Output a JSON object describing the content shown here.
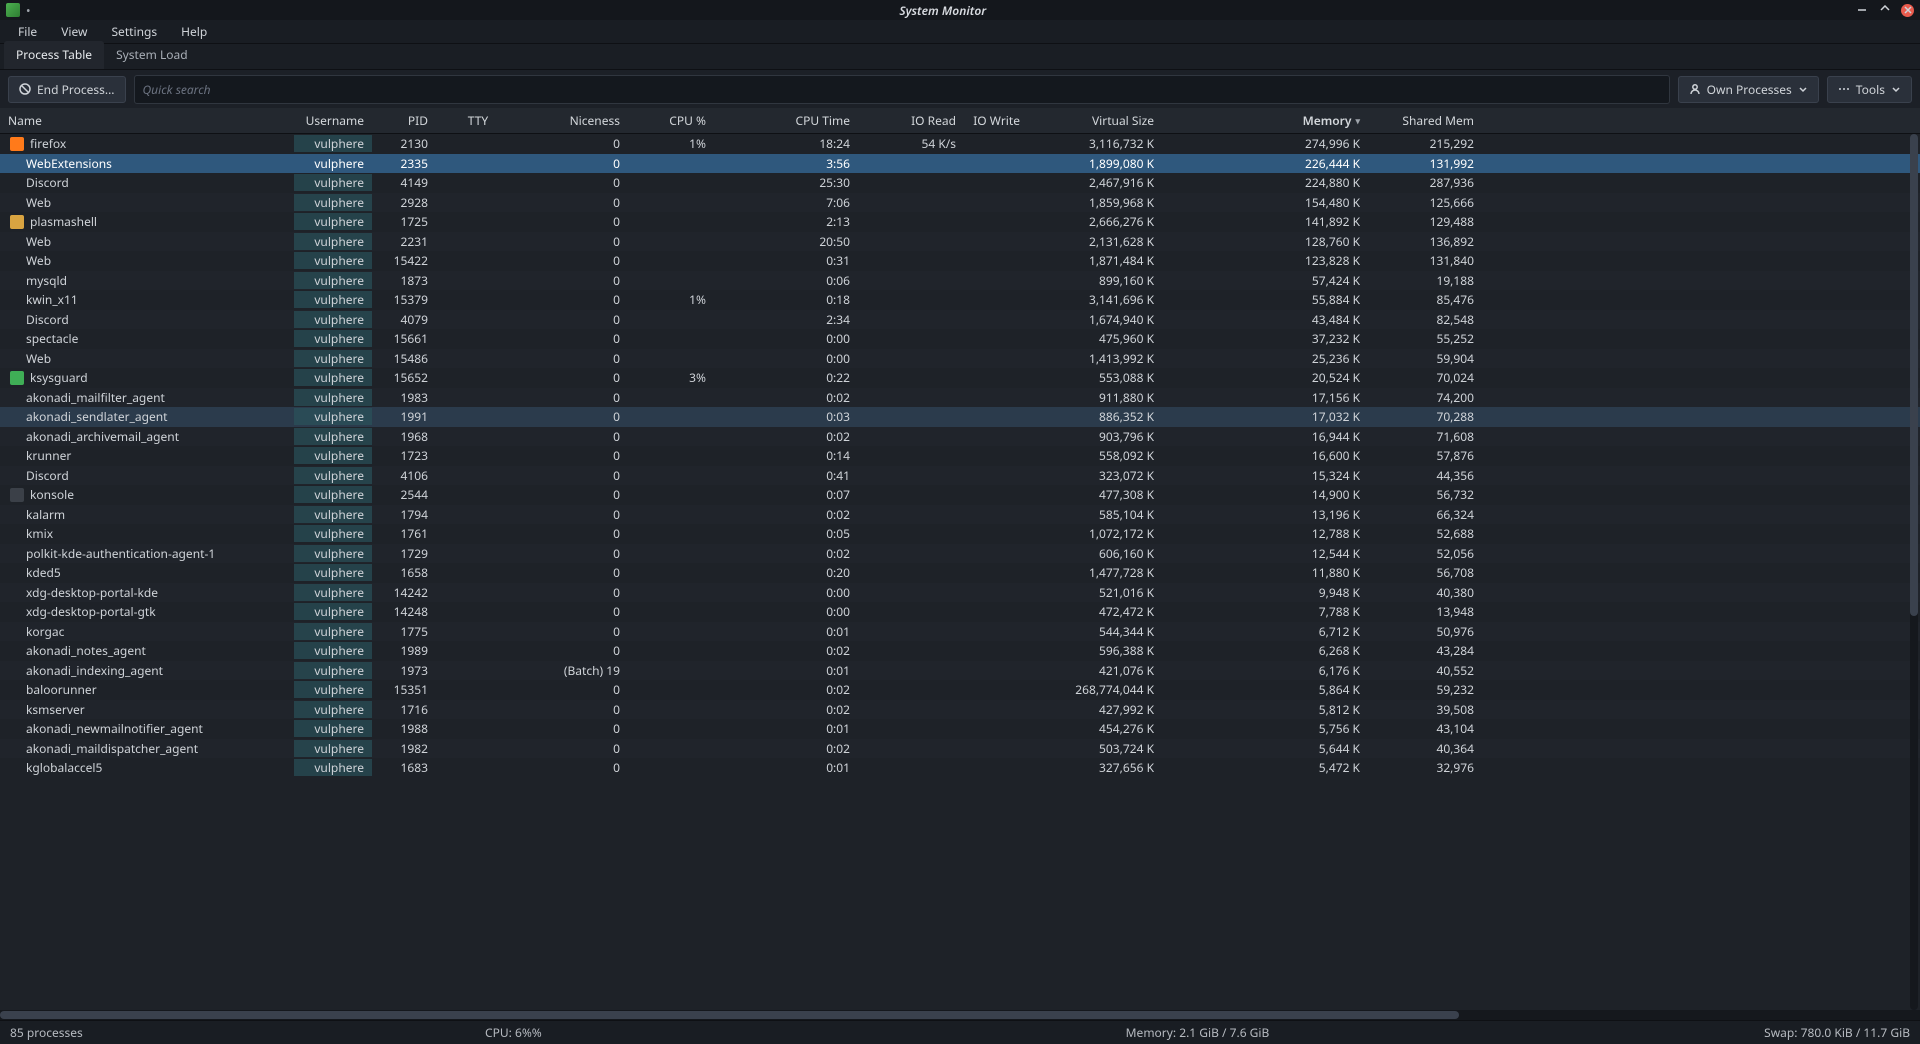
{
  "window": {
    "title": "System Monitor",
    "modified_mark": "•"
  },
  "menubar": [
    "File",
    "View",
    "Settings",
    "Help"
  ],
  "tabs": [
    {
      "label": "Process Table",
      "active": true
    },
    {
      "label": "System Load",
      "active": false
    }
  ],
  "toolbar": {
    "end_process_label": "End Process...",
    "search_placeholder": "Quick search",
    "filter_label": "Own Processes",
    "tools_label": "Tools"
  },
  "columns": [
    {
      "label": "Name",
      "align": "left"
    },
    {
      "label": "Username",
      "align": "right"
    },
    {
      "label": "PID",
      "align": "right"
    },
    {
      "label": "TTY",
      "align": "center"
    },
    {
      "label": "Niceness",
      "align": "right"
    },
    {
      "label": "CPU %",
      "align": "right"
    },
    {
      "label": "CPU Time",
      "align": "right"
    },
    {
      "label": "IO Read",
      "align": "right"
    },
    {
      "label": "IO Write",
      "align": "right"
    },
    {
      "label": "Virtual Size",
      "align": "right"
    },
    {
      "label": "Memory",
      "align": "right",
      "sorted": true
    },
    {
      "label": "Shared Mem",
      "align": "right"
    }
  ],
  "rows": [
    {
      "depth": 1,
      "icon": "firefox",
      "name": "firefox",
      "user": "vulphere",
      "pid": "2130",
      "tty": "",
      "nice": "0",
      "cpu": "1%",
      "cputime": "18:24",
      "ioread": "54 K/s",
      "iowrite": "",
      "vsize": "3,116,732 K",
      "mem": "274,996 K",
      "shmem": "215,292"
    },
    {
      "depth": 2,
      "name": "WebExtensions",
      "user": "vulphere",
      "pid": "2335",
      "tty": "",
      "nice": "0",
      "cpu": "",
      "cputime": "3:56",
      "ioread": "",
      "iowrite": "",
      "vsize": "1,899,080 K",
      "mem": "226,444 K",
      "shmem": "131,992",
      "selected": true
    },
    {
      "depth": 2,
      "name": "Discord",
      "user": "vulphere",
      "pid": "4149",
      "tty": "",
      "nice": "0",
      "cpu": "",
      "cputime": "25:30",
      "ioread": "",
      "iowrite": "",
      "vsize": "2,467,916 K",
      "mem": "224,880 K",
      "shmem": "287,936"
    },
    {
      "depth": 2,
      "name": "Web",
      "user": "vulphere",
      "pid": "2928",
      "tty": "",
      "nice": "0",
      "cpu": "",
      "cputime": "7:06",
      "ioread": "",
      "iowrite": "",
      "vsize": "1,859,968 K",
      "mem": "154,480 K",
      "shmem": "125,666"
    },
    {
      "depth": 1,
      "icon": "plasma",
      "name": "plasmashell",
      "user": "vulphere",
      "pid": "1725",
      "tty": "",
      "nice": "0",
      "cpu": "",
      "cputime": "2:13",
      "ioread": "",
      "iowrite": "",
      "vsize": "2,666,276 K",
      "mem": "141,892 K",
      "shmem": "129,488"
    },
    {
      "depth": 2,
      "name": "Web",
      "user": "vulphere",
      "pid": "2231",
      "tty": "",
      "nice": "0",
      "cpu": "",
      "cputime": "20:50",
      "ioread": "",
      "iowrite": "",
      "vsize": "2,131,628 K",
      "mem": "128,760 K",
      "shmem": "136,892"
    },
    {
      "depth": 2,
      "name": "Web",
      "user": "vulphere",
      "pid": "15422",
      "tty": "",
      "nice": "0",
      "cpu": "",
      "cputime": "0:31",
      "ioread": "",
      "iowrite": "",
      "vsize": "1,871,484 K",
      "mem": "123,828 K",
      "shmem": "131,840"
    },
    {
      "depth": 2,
      "name": "mysqld",
      "user": "vulphere",
      "pid": "1873",
      "tty": "",
      "nice": "0",
      "cpu": "",
      "cputime": "0:06",
      "ioread": "",
      "iowrite": "",
      "vsize": "899,160 K",
      "mem": "57,424 K",
      "shmem": "19,188"
    },
    {
      "depth": 2,
      "name": "kwin_x11",
      "user": "vulphere",
      "pid": "15379",
      "tty": "",
      "nice": "0",
      "cpu": "1%",
      "cputime": "0:18",
      "ioread": "",
      "iowrite": "",
      "vsize": "3,141,696 K",
      "mem": "55,884 K",
      "shmem": "85,476"
    },
    {
      "depth": 2,
      "name": "Discord",
      "user": "vulphere",
      "pid": "4079",
      "tty": "",
      "nice": "0",
      "cpu": "",
      "cputime": "2:34",
      "ioread": "",
      "iowrite": "",
      "vsize": "1,674,940 K",
      "mem": "43,484 K",
      "shmem": "82,548"
    },
    {
      "depth": 2,
      "name": "spectacle",
      "user": "vulphere",
      "pid": "15661",
      "tty": "",
      "nice": "0",
      "cpu": "",
      "cputime": "0:00",
      "ioread": "",
      "iowrite": "",
      "vsize": "475,960 K",
      "mem": "37,232 K",
      "shmem": "55,252"
    },
    {
      "depth": 2,
      "name": "Web",
      "user": "vulphere",
      "pid": "15486",
      "tty": "",
      "nice": "0",
      "cpu": "",
      "cputime": "0:00",
      "ioread": "",
      "iowrite": "",
      "vsize": "1,413,992 K",
      "mem": "25,236 K",
      "shmem": "59,904"
    },
    {
      "depth": 1,
      "icon": "ksysguard",
      "name": "ksysguard",
      "user": "vulphere",
      "pid": "15652",
      "tty": "",
      "nice": "0",
      "cpu": "3%",
      "cputime": "0:22",
      "ioread": "",
      "iowrite": "",
      "vsize": "553,088 K",
      "mem": "20,524 K",
      "shmem": "70,024"
    },
    {
      "depth": 2,
      "name": "akonadi_mailfilter_agent",
      "user": "vulphere",
      "pid": "1983",
      "tty": "",
      "nice": "0",
      "cpu": "",
      "cputime": "0:02",
      "ioread": "",
      "iowrite": "",
      "vsize": "911,880 K",
      "mem": "17,156 K",
      "shmem": "74,200"
    },
    {
      "depth": 2,
      "name": "akonadi_sendlater_agent",
      "user": "vulphere",
      "pid": "1991",
      "tty": "",
      "nice": "0",
      "cpu": "",
      "cputime": "0:03",
      "ioread": "",
      "iowrite": "",
      "vsize": "886,352 K",
      "mem": "17,032 K",
      "shmem": "70,288",
      "hover": true
    },
    {
      "depth": 2,
      "name": "akonadi_archivemail_agent",
      "user": "vulphere",
      "pid": "1968",
      "tty": "",
      "nice": "0",
      "cpu": "",
      "cputime": "0:02",
      "ioread": "",
      "iowrite": "",
      "vsize": "903,796 K",
      "mem": "16,944 K",
      "shmem": "71,608"
    },
    {
      "depth": 2,
      "name": "krunner",
      "user": "vulphere",
      "pid": "1723",
      "tty": "",
      "nice": "0",
      "cpu": "",
      "cputime": "0:14",
      "ioread": "",
      "iowrite": "",
      "vsize": "558,092 K",
      "mem": "16,600 K",
      "shmem": "57,876"
    },
    {
      "depth": 2,
      "name": "Discord",
      "user": "vulphere",
      "pid": "4106",
      "tty": "",
      "nice": "0",
      "cpu": "",
      "cputime": "0:41",
      "ioread": "",
      "iowrite": "",
      "vsize": "323,072 K",
      "mem": "15,324 K",
      "shmem": "44,356"
    },
    {
      "depth": 1,
      "icon": "konsole",
      "name": "konsole",
      "user": "vulphere",
      "pid": "2544",
      "tty": "",
      "nice": "0",
      "cpu": "",
      "cputime": "0:07",
      "ioread": "",
      "iowrite": "",
      "vsize": "477,308 K",
      "mem": "14,900 K",
      "shmem": "56,732"
    },
    {
      "depth": 2,
      "name": "kalarm",
      "user": "vulphere",
      "pid": "1794",
      "tty": "",
      "nice": "0",
      "cpu": "",
      "cputime": "0:02",
      "ioread": "",
      "iowrite": "",
      "vsize": "585,104 K",
      "mem": "13,196 K",
      "shmem": "66,324"
    },
    {
      "depth": 2,
      "name": "kmix",
      "user": "vulphere",
      "pid": "1761",
      "tty": "",
      "nice": "0",
      "cpu": "",
      "cputime": "0:05",
      "ioread": "",
      "iowrite": "",
      "vsize": "1,072,172 K",
      "mem": "12,788 K",
      "shmem": "52,688"
    },
    {
      "depth": 2,
      "name": "polkit-kde-authentication-agent-1",
      "user": "vulphere",
      "pid": "1729",
      "tty": "",
      "nice": "0",
      "cpu": "",
      "cputime": "0:02",
      "ioread": "",
      "iowrite": "",
      "vsize": "606,160 K",
      "mem": "12,544 K",
      "shmem": "52,056"
    },
    {
      "depth": 2,
      "name": "kded5",
      "user": "vulphere",
      "pid": "1658",
      "tty": "",
      "nice": "0",
      "cpu": "",
      "cputime": "0:20",
      "ioread": "",
      "iowrite": "",
      "vsize": "1,477,728 K",
      "mem": "11,880 K",
      "shmem": "56,708"
    },
    {
      "depth": 2,
      "name": "xdg-desktop-portal-kde",
      "user": "vulphere",
      "pid": "14242",
      "tty": "",
      "nice": "0",
      "cpu": "",
      "cputime": "0:00",
      "ioread": "",
      "iowrite": "",
      "vsize": "521,016 K",
      "mem": "9,948 K",
      "shmem": "40,380"
    },
    {
      "depth": 2,
      "name": "xdg-desktop-portal-gtk",
      "user": "vulphere",
      "pid": "14248",
      "tty": "",
      "nice": "0",
      "cpu": "",
      "cputime": "0:00",
      "ioread": "",
      "iowrite": "",
      "vsize": "472,472 K",
      "mem": "7,788 K",
      "shmem": "13,948"
    },
    {
      "depth": 2,
      "name": "korgac",
      "user": "vulphere",
      "pid": "1775",
      "tty": "",
      "nice": "0",
      "cpu": "",
      "cputime": "0:01",
      "ioread": "",
      "iowrite": "",
      "vsize": "544,344 K",
      "mem": "6,712 K",
      "shmem": "50,976"
    },
    {
      "depth": 2,
      "name": "akonadi_notes_agent",
      "user": "vulphere",
      "pid": "1989",
      "tty": "",
      "nice": "0",
      "cpu": "",
      "cputime": "0:02",
      "ioread": "",
      "iowrite": "",
      "vsize": "596,388 K",
      "mem": "6,268 K",
      "shmem": "43,284"
    },
    {
      "depth": 2,
      "name": "akonadi_indexing_agent",
      "user": "vulphere",
      "pid": "1973",
      "tty": "",
      "nice": "(Batch) 19",
      "cpu": "",
      "cputime": "0:01",
      "ioread": "",
      "iowrite": "",
      "vsize": "421,076 K",
      "mem": "6,176 K",
      "shmem": "40,552"
    },
    {
      "depth": 2,
      "name": "baloorunner",
      "user": "vulphere",
      "pid": "15351",
      "tty": "",
      "nice": "0",
      "cpu": "",
      "cputime": "0:02",
      "ioread": "",
      "iowrite": "",
      "vsize": "268,774,044 K",
      "mem": "5,864 K",
      "shmem": "59,232"
    },
    {
      "depth": 2,
      "name": "ksmserver",
      "user": "vulphere",
      "pid": "1716",
      "tty": "",
      "nice": "0",
      "cpu": "",
      "cputime": "0:02",
      "ioread": "",
      "iowrite": "",
      "vsize": "427,992 K",
      "mem": "5,812 K",
      "shmem": "39,508"
    },
    {
      "depth": 2,
      "name": "akonadi_newmailnotifier_agent",
      "user": "vulphere",
      "pid": "1988",
      "tty": "",
      "nice": "0",
      "cpu": "",
      "cputime": "0:01",
      "ioread": "",
      "iowrite": "",
      "vsize": "454,276 K",
      "mem": "5,756 K",
      "shmem": "43,104"
    },
    {
      "depth": 2,
      "name": "akonadi_maildispatcher_agent",
      "user": "vulphere",
      "pid": "1982",
      "tty": "",
      "nice": "0",
      "cpu": "",
      "cputime": "0:02",
      "ioread": "",
      "iowrite": "",
      "vsize": "503,724 K",
      "mem": "5,644 K",
      "shmem": "40,364"
    },
    {
      "depth": 2,
      "name": "kglobalaccel5",
      "user": "vulphere",
      "pid": "1683",
      "tty": "",
      "nice": "0",
      "cpu": "",
      "cputime": "0:01",
      "ioread": "",
      "iowrite": "",
      "vsize": "327,656 K",
      "mem": "5,472 K",
      "shmem": "32,976"
    }
  ],
  "statusbar": {
    "count": "85 processes",
    "cpu": "CPU: 6%%",
    "memory": "Memory: 2.1 GiB / 7.6 GiB",
    "swap": "Swap: 780.0 KiB / 11.7 GiB"
  },
  "icons": {
    "firefox": "#ff7a1a",
    "plasma": "#d9a441",
    "ksysguard": "#3fae56",
    "konsole": "#3b4048"
  }
}
